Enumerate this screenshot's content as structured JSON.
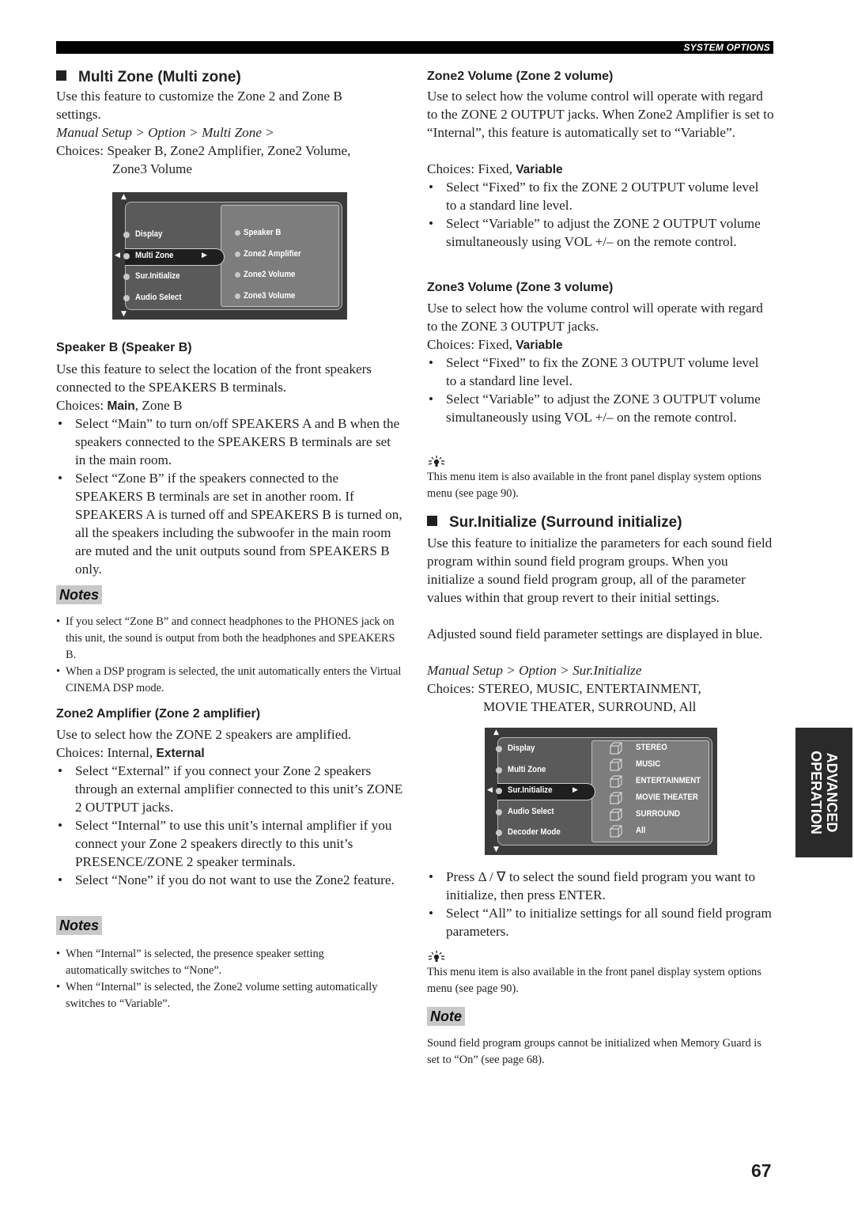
{
  "header": {
    "section_label": "SYSTEM OPTIONS"
  },
  "side_tab": {
    "line1": "ADVANCED",
    "line2": "OPERATION"
  },
  "page_number": "67",
  "multi_zone": {
    "title": "Multi Zone (Multi zone)",
    "intro": "Use this feature to customize the Zone 2 and Zone B settings.",
    "path": "Manual Setup > Option > Multi Zone >",
    "choices_label": "Choices:",
    "choices_line1": "Speaker B, Zone2 Amplifier, Zone2 Volume,",
    "choices_line2": "Zone3 Volume",
    "osd": {
      "left_items": [
        "Display",
        "Multi Zone",
        "Sur.Initialize",
        "Audio Select"
      ],
      "selected_index": 1,
      "right_items": [
        "Speaker B",
        "Zone2 Amplifier",
        "Zone2 Volume",
        "Zone3 Volume"
      ]
    }
  },
  "speaker_b": {
    "title": "Speaker B (Speaker B)",
    "intro": "Use this feature to select the location of the front speakers connected to the SPEAKERS B terminals.",
    "choices_prefix": "Choices: ",
    "choices_default": "Main",
    "choices_rest": ", Zone B",
    "bullets": [
      "Select “Main” to turn on/off SPEAKERS A and B when the speakers connected to the SPEAKERS B terminals are set in the main room.",
      "Select “Zone B” if the speakers connected to the SPEAKERS B terminals are set in another room. If SPEAKERS A is turned off and SPEAKERS B is turned on, all the speakers including the subwoofer in the main room are muted and the unit outputs sound from SPEAKERS B only."
    ],
    "notes_label": "Notes",
    "notes": [
      "If you select “Zone B” and connect headphones to the PHONES jack on this unit, the sound is output from both the headphones and SPEAKERS B.",
      "When a DSP program is selected, the unit automatically enters the Virtual CINEMA DSP mode."
    ]
  },
  "zone2_amp": {
    "title": "Zone2 Amplifier (Zone 2 amplifier)",
    "intro": "Use to select how the ZONE 2 speakers are amplified.",
    "choices_prefix": "Choices: Internal, ",
    "choices_default": "External",
    "bullets": [
      "Select “External” if you connect your Zone 2 speakers through an external amplifier connected to this unit’s ZONE 2 OUTPUT jacks.",
      "Select “Internal” to use this unit’s internal amplifier if you connect your Zone 2 speakers directly to this unit’s PRESENCE/ZONE 2 speaker terminals.",
      "Select “None” if you do not want to use the Zone2 feature."
    ],
    "notes_label": "Notes",
    "notes": [
      "When “Internal” is selected, the presence speaker setting automatically switches to “None”.",
      "When “Internal” is selected, the Zone2 volume setting automatically switches to “Variable”."
    ]
  },
  "zone2_vol": {
    "title": "Zone2 Volume (Zone 2 volume)",
    "intro": "Use to select how the volume control will operate with regard to the ZONE 2 OUTPUT jacks. When Zone2 Amplifier is set to “Internal”, this feature is automatically set to “Variable”.",
    "choices_prefix": "Choices: Fixed, ",
    "choices_default": "Variable",
    "bullets": [
      "Select “Fixed” to fix the ZONE 2 OUTPUT volume level to a standard line level.",
      "Select “Variable” to adjust the ZONE 2 OUTPUT volume simultaneously using VOL +/– on the remote control."
    ]
  },
  "zone3_vol": {
    "title": "Zone3 Volume (Zone 3 volume)",
    "intro": "Use to select how the volume control will operate with regard to the ZONE 3 OUTPUT jacks.",
    "choices_prefix": "Choices: Fixed, ",
    "choices_default": "Variable",
    "bullets": [
      "Select “Fixed” to fix the ZONE 3 OUTPUT volume level to a standard line level.",
      "Select “Variable” to adjust the ZONE 3 OUTPUT volume simultaneously using VOL +/– on the remote control."
    ],
    "tip_icon": "lightbulb-tip-icon",
    "tip": "This menu item is also available in the front panel display system options menu (see page 90)."
  },
  "sur_init": {
    "title": "Sur.Initialize (Surround initialize)",
    "intro1": "Use this feature to initialize the parameters for each sound field program within sound field program groups. When you initialize a sound field program group, all of the parameter values within that group revert to their initial settings.",
    "intro2": "Adjusted sound field parameter settings are displayed in blue.",
    "path": "Manual Setup > Option > Sur.Initialize",
    "choices_label": "Choices:",
    "choices_line1": "STEREO, MUSIC, ENTERTAINMENT,",
    "choices_line2": "MOVIE THEATER, SURROUND, All",
    "osd": {
      "left_items": [
        "Display",
        "Multi Zone",
        "Sur.Initialize",
        "Audio Select",
        "Decoder Mode"
      ],
      "selected_index": 2,
      "right_items": [
        "STEREO",
        "MUSIC",
        "ENTERTAINMENT",
        "MOVIE THEATER",
        "SURROUND",
        "All"
      ]
    },
    "bullets": [
      "Press Δ / ∇ to select the sound field program you want to initialize, then press ENTER.",
      "Select “All” to initialize settings for all sound field program parameters."
    ],
    "tip": "This menu item is also available in the front panel display system options menu (see page 90).",
    "note_label": "Note",
    "note": "Sound field program groups cannot be initialized when Memory Guard is set to “On” (see page 68)."
  }
}
